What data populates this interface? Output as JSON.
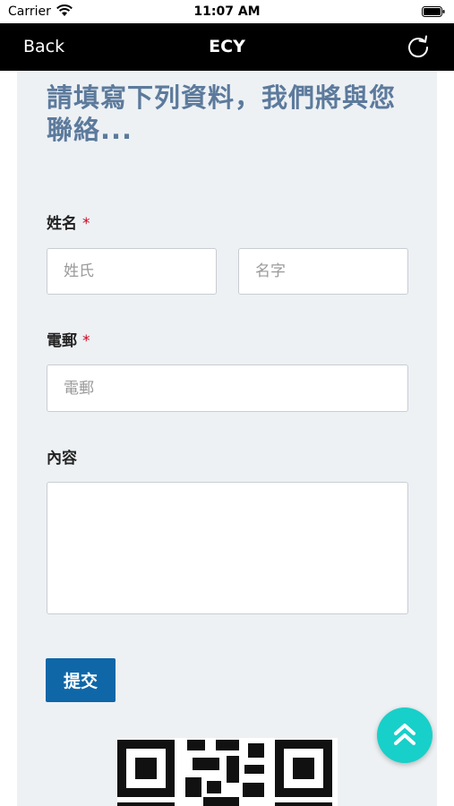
{
  "status_bar": {
    "carrier": "Carrier",
    "time": "11:07 AM"
  },
  "nav": {
    "back_label": "Back",
    "title": "ECY",
    "refresh_icon": "refresh-icon"
  },
  "form": {
    "heading": "請填寫下列資料，我們將與您聯絡...",
    "name_label": "姓名",
    "required_mark": "*",
    "last_name_placeholder": "姓氏",
    "first_name_placeholder": "名字",
    "email_label": "電郵",
    "email_placeholder": "電郵",
    "content_label": "內容",
    "content_value": "",
    "submit_label": "提交"
  },
  "colors": {
    "nav_background": "#000000",
    "heading": "#5c7a9c",
    "submit": "#0f67a8",
    "scroll_top": "#17d0c9",
    "required": "#d0021b"
  },
  "icons": {
    "scroll_top": "double-chevron-up-icon",
    "qr": "qr-code-icon"
  }
}
